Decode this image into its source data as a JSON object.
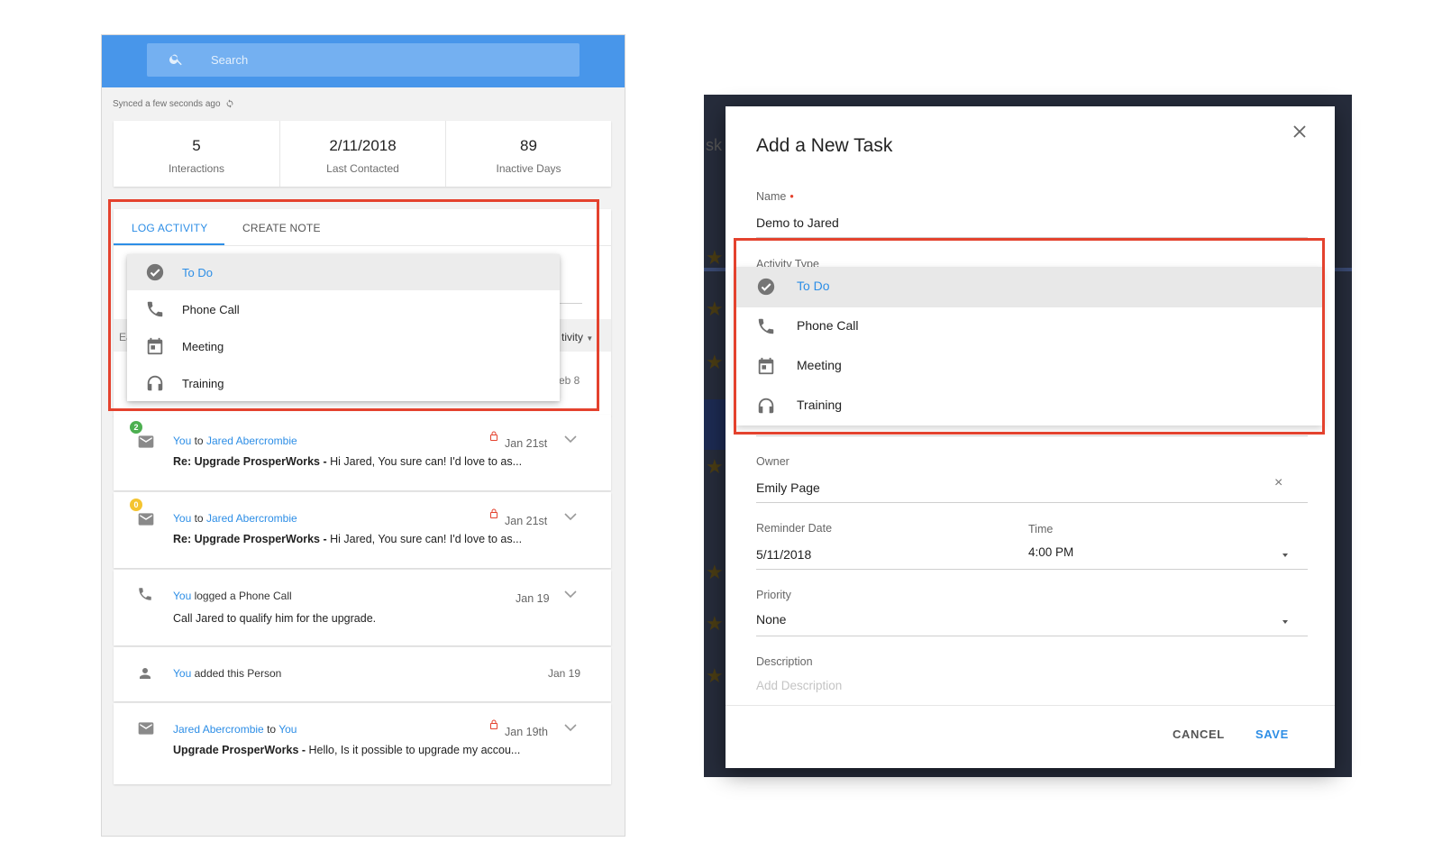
{
  "colors": {
    "accent": "#2d8ee6",
    "header": "#4896ea",
    "highlight": "#e4422e",
    "backdrop": "#262c3b"
  },
  "left": {
    "search": {
      "placeholder": "Search",
      "icon": "search-icon"
    },
    "synced": "Synced a few seconds ago",
    "stats": [
      {
        "value": "5",
        "label": "Interactions"
      },
      {
        "value": "2/11/2018",
        "label": "Last Contacted"
      },
      {
        "value": "89",
        "label": "Inactive Days"
      }
    ],
    "tabs": {
      "log_activity": "LOG ACTIVITY",
      "create_note": "CREATE NOTE"
    },
    "background": {
      "col_ea": "Ea",
      "col_activity": "tivity",
      "date_partial": "eb 8"
    },
    "activity_types": [
      {
        "label": "To Do",
        "icon": "check-circle-icon",
        "selected": true
      },
      {
        "label": "Phone Call",
        "icon": "phone-icon"
      },
      {
        "label": "Meeting",
        "icon": "calendar-icon"
      },
      {
        "label": "Training",
        "icon": "headphones-icon"
      }
    ],
    "feed": [
      {
        "icon": "email-icon",
        "badge": "2",
        "badge_color": "#4caf50",
        "from": "You",
        "mid": "to",
        "to": "Jared Abercrombie",
        "subject": "Re: Upgrade ProsperWorks -",
        "snippet": " Hi Jared,  You sure can! I'd love to as...",
        "date": "Jan 21st",
        "locked": true
      },
      {
        "icon": "email-icon",
        "badge": "0",
        "badge_color": "#f4c430",
        "from": "You",
        "mid": "to",
        "to": "Jared Abercrombie",
        "subject": "Re: Upgrade ProsperWorks -",
        "snippet": " Hi Jared,  You sure can! I'd love to as...",
        "date": "Jan 21st",
        "locked": true
      },
      {
        "icon": "phone-icon",
        "from": "You",
        "mid": "logged a Phone Call",
        "to": "",
        "body": "Call Jared to qualify him for the upgrade.",
        "date": "Jan 19"
      },
      {
        "icon": "person-icon",
        "from": "You",
        "mid": "added this Person",
        "to": "",
        "date": "Jan 19"
      },
      {
        "icon": "email-icon",
        "from": "Jared Abercrombie",
        "mid": "to",
        "to": "You",
        "subject": "Upgrade ProsperWorks -",
        "snippet": " Hello, Is it possible to upgrade my accou...",
        "date": "Jan 19th",
        "locked": true
      }
    ]
  },
  "modal": {
    "title": "Add a New Task",
    "name": {
      "label": "Name",
      "required": "•",
      "value": "Demo to Jared"
    },
    "activity_type": {
      "label": "Activity Type"
    },
    "owner": {
      "label": "Owner",
      "value": "Emily Page",
      "clear": "×"
    },
    "reminder_date": {
      "label": "Reminder Date",
      "value": "5/11/2018"
    },
    "time": {
      "label": "Time",
      "value": "4:00 PM"
    },
    "priority": {
      "label": "Priority",
      "value": "None"
    },
    "description": {
      "label": "Description",
      "placeholder": "Add Description"
    },
    "cancel": "CANCEL",
    "save": "SAVE",
    "backdrop_text": "sk"
  }
}
